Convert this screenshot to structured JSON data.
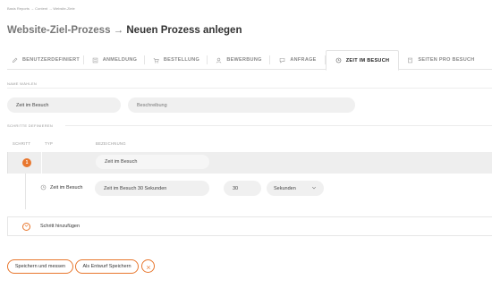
{
  "breadcrumb": "Basis Reports → Content → Website-Ziele",
  "title": {
    "prefix": "Website-Ziel-Prozess",
    "arrow": "→",
    "main": "Neuen Prozess anlegen"
  },
  "tabs": [
    {
      "label": "BENUTZERDEFINIERT",
      "icon": "pencil-icon"
    },
    {
      "label": "ANMELDUNG",
      "icon": "form-icon"
    },
    {
      "label": "BESTELLUNG",
      "icon": "cart-icon"
    },
    {
      "label": "BEWERBUNG",
      "icon": "user-icon"
    },
    {
      "label": "ANFRAGE",
      "icon": "chat-icon"
    },
    {
      "label": "ZEIT IM BESUCH",
      "icon": "clock-icon",
      "active": true
    },
    {
      "label": "SEITEN PRO BESUCH",
      "icon": "page-icon"
    }
  ],
  "name_section": {
    "label": "NAME WÄHLEN",
    "name_value": "Zeit im Besuch",
    "description_placeholder": "Beschreibung"
  },
  "steps_section": {
    "label": "SCHRITTE DEFINIEREN",
    "columns": {
      "step": "SCHRITT",
      "type": "TYP",
      "designation": "BEZEICHNUNG"
    },
    "step": {
      "number": "1",
      "designation": "Zeit im Besuch",
      "type_label": "Zeit im Besuch",
      "type_icon": "clock-icon",
      "detail_designation": "Zeit im Besuch 30 Sekunden",
      "amount": "30",
      "unit": "Sekunden"
    },
    "add_step_label": "Schritt hinzufügen"
  },
  "actions": {
    "save_and_measure": "Speichern und messen",
    "save_draft": "Als Entwurf Speichern"
  },
  "colors": {
    "accent": "#e8772e",
    "field_bg": "#f0f0f0",
    "row_bg": "#eeeeee"
  }
}
